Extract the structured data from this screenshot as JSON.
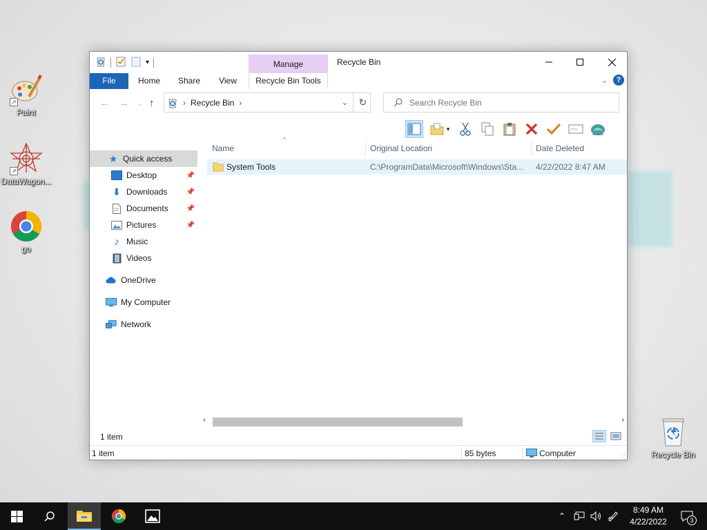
{
  "desktop": {
    "icons": [
      {
        "label": "Paint"
      },
      {
        "label": "DataWagon..."
      },
      {
        "label": "go"
      },
      {
        "label": "Recycle Bin"
      }
    ]
  },
  "window": {
    "title": "Recycle Bin",
    "controls": {
      "minimize": "—",
      "maximize": "☐",
      "close": "✕"
    },
    "ribbon": {
      "contextual_group": "Manage",
      "tabs": [
        "File",
        "Home",
        "Share",
        "View",
        "Recycle Bin Tools"
      ]
    },
    "address": {
      "path": [
        "Recycle Bin"
      ]
    },
    "search": {
      "placeholder": "Search Recycle Bin"
    },
    "nav_pane": {
      "quick_access": "Quick access",
      "items": [
        {
          "label": "Desktop",
          "pinned": true
        },
        {
          "label": "Downloads",
          "pinned": true
        },
        {
          "label": "Documents",
          "pinned": true
        },
        {
          "label": "Pictures",
          "pinned": true
        },
        {
          "label": "Music",
          "pinned": false
        },
        {
          "label": "Videos",
          "pinned": false
        }
      ],
      "onedrive": "OneDrive",
      "my_computer": "My Computer",
      "network": "Network"
    },
    "columns": [
      "Name",
      "Original Location",
      "Date Deleted"
    ],
    "files": [
      {
        "name": "System Tools",
        "original_location": "C:\\ProgramData\\Microsoft\\Windows\\Sta...",
        "date_deleted": "4/22/2022 8:47 AM"
      }
    ],
    "item_count": "1 item",
    "status": {
      "items": "1 item",
      "size": "85 bytes",
      "location": "Computer"
    }
  },
  "taskbar": {
    "clock": {
      "time": "8:49 AM",
      "date": "4/22/2022"
    },
    "notifications": "3"
  },
  "colors": {
    "accent": "#1a65b5",
    "manage_tab": "#e6cff4",
    "selected_row": "#e5f3fb",
    "taskbar": "#101010"
  }
}
